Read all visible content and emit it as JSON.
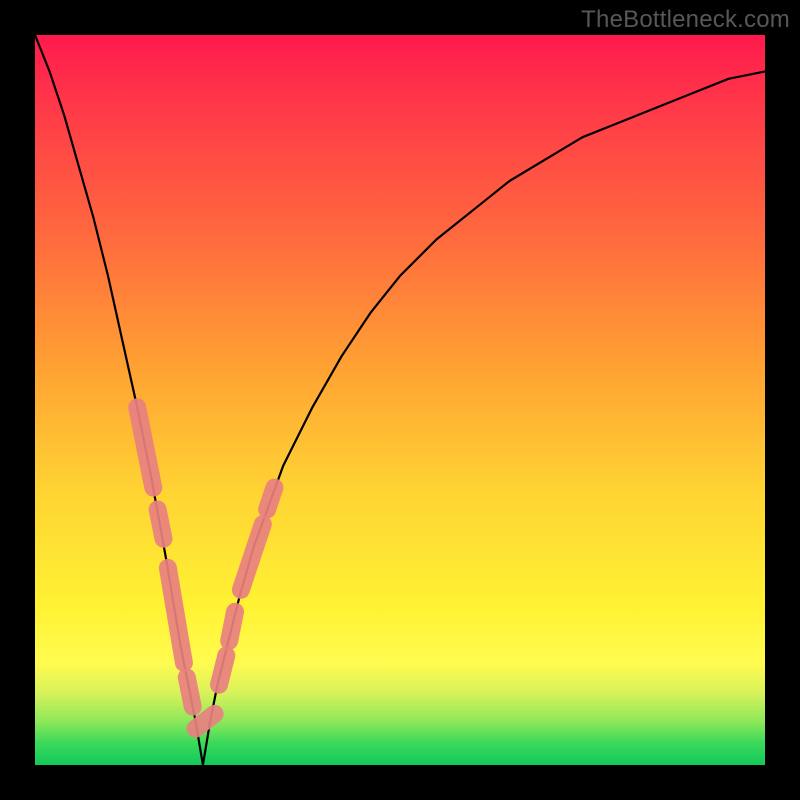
{
  "watermark": "TheBottleneck.com",
  "colors": {
    "curve": "#000000",
    "overlay": "#e88080",
    "frame": "#000000"
  },
  "chart_data": {
    "type": "line",
    "title": "",
    "xlabel": "",
    "ylabel": "",
    "xlim": [
      0,
      100
    ],
    "ylim": [
      0,
      100
    ],
    "grid": false,
    "legend": false,
    "notes": "V-shaped bottleneck curve. y ≈ 100·|1 - x/23|^0.6 — 0 at x≈23, rises on both sides. Pink overlay marks data-point cluster near the minimum.",
    "series": [
      {
        "name": "bottleneck_curve",
        "x": [
          0,
          2,
          4,
          6,
          8,
          10,
          12,
          14,
          16,
          18,
          20,
          21,
          22,
          23,
          24,
          25,
          26,
          28,
          30,
          34,
          38,
          42,
          46,
          50,
          55,
          60,
          65,
          70,
          75,
          80,
          85,
          90,
          95,
          100
        ],
        "y": [
          100,
          95,
          89,
          82,
          75,
          67,
          58,
          49,
          39,
          28,
          16,
          11,
          6,
          0,
          6,
          11,
          15,
          23,
          30,
          41,
          49,
          56,
          62,
          67,
          72,
          76,
          80,
          83,
          86,
          88,
          90,
          92,
          94,
          95
        ]
      }
    ],
    "overlay_segments": [
      {
        "x": [
          14.0,
          16.2
        ],
        "y": [
          49,
          38
        ]
      },
      {
        "x": [
          16.8,
          17.6
        ],
        "y": [
          35,
          31
        ]
      },
      {
        "x": [
          18.2,
          20.4
        ],
        "y": [
          27,
          14
        ]
      },
      {
        "x": [
          20.8,
          21.6
        ],
        "y": [
          12,
          8
        ]
      },
      {
        "x": [
          22.0,
          24.6
        ],
        "y": [
          5,
          7
        ]
      },
      {
        "x": [
          25.2,
          26.2
        ],
        "y": [
          11,
          15
        ]
      },
      {
        "x": [
          26.6,
          27.4
        ],
        "y": [
          17,
          21
        ]
      },
      {
        "x": [
          28.2,
          31.2
        ],
        "y": [
          24,
          33
        ]
      },
      {
        "x": [
          31.8,
          32.8
        ],
        "y": [
          35,
          38
        ]
      }
    ]
  }
}
